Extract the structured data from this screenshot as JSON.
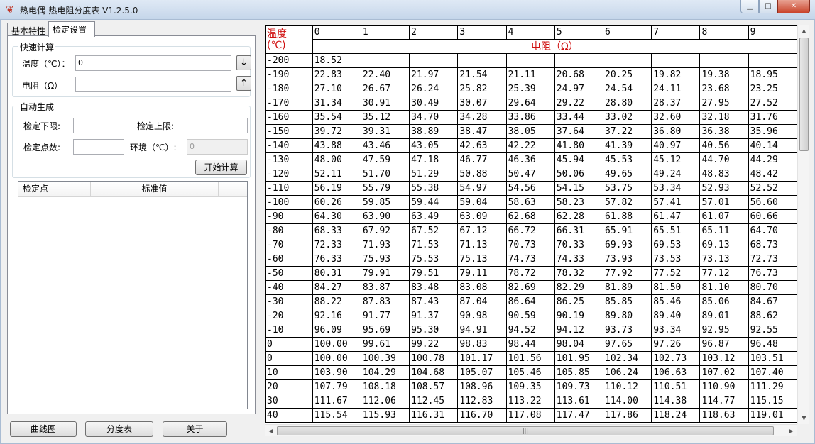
{
  "window": {
    "title": "热电偶-热电阻分度表 V1.2.5.0",
    "app_icon": "flame-icon",
    "minimize": "▁",
    "maximize": "□",
    "close": "✕"
  },
  "tabs": [
    {
      "label": "基本特性"
    },
    {
      "label": "检定设置"
    }
  ],
  "quick_calc": {
    "title": "快速计算",
    "temp_label": "温度（℃）：",
    "temp_value": "0",
    "res_label": "电阻（Ω）",
    "res_value": "",
    "down_arrow": "↓",
    "up_arrow": "↑"
  },
  "auto_gen": {
    "title": "自动生成",
    "lower_label": "检定下限:",
    "upper_label": "检定上限:",
    "points_label": "检定点数:",
    "env_label": "环境（℃）:",
    "env_value": "0",
    "start_button": "开始计算"
  },
  "listview": {
    "columns": [
      "检定点",
      "标准值"
    ]
  },
  "bottom_buttons": {
    "curve": "曲线图",
    "table": "分度表",
    "about": "关于"
  },
  "resistance_table": {
    "temp_header": "温度\n(℃)",
    "temp_header_line1": "温度",
    "temp_header_line2": "(℃)",
    "res_header": "电阻（Ω）",
    "columns": [
      "0",
      "1",
      "2",
      "3",
      "4",
      "5",
      "6",
      "7",
      "8",
      "9"
    ],
    "rows": [
      {
        "t": "-200",
        "v": [
          "18.52",
          "",
          "",
          "",
          "",
          "",
          "",
          "",
          "",
          ""
        ]
      },
      {
        "t": "-190",
        "v": [
          "22.83",
          "22.40",
          "21.97",
          "21.54",
          "21.11",
          "20.68",
          "20.25",
          "19.82",
          "19.38",
          "18.95"
        ]
      },
      {
        "t": "-180",
        "v": [
          "27.10",
          "26.67",
          "26.24",
          "25.82",
          "25.39",
          "24.97",
          "24.54",
          "24.11",
          "23.68",
          "23.25"
        ]
      },
      {
        "t": "-170",
        "v": [
          "31.34",
          "30.91",
          "30.49",
          "30.07",
          "29.64",
          "29.22",
          "28.80",
          "28.37",
          "27.95",
          "27.52"
        ]
      },
      {
        "t": "-160",
        "v": [
          "35.54",
          "35.12",
          "34.70",
          "34.28",
          "33.86",
          "33.44",
          "33.02",
          "32.60",
          "32.18",
          "31.76"
        ]
      },
      {
        "t": "-150",
        "v": [
          "39.72",
          "39.31",
          "38.89",
          "38.47",
          "38.05",
          "37.64",
          "37.22",
          "36.80",
          "36.38",
          "35.96"
        ]
      },
      {
        "t": "-140",
        "v": [
          "43.88",
          "43.46",
          "43.05",
          "42.63",
          "42.22",
          "41.80",
          "41.39",
          "40.97",
          "40.56",
          "40.14"
        ]
      },
      {
        "t": "-130",
        "v": [
          "48.00",
          "47.59",
          "47.18",
          "46.77",
          "46.36",
          "45.94",
          "45.53",
          "45.12",
          "44.70",
          "44.29"
        ]
      },
      {
        "t": "-120",
        "v": [
          "52.11",
          "51.70",
          "51.29",
          "50.88",
          "50.47",
          "50.06",
          "49.65",
          "49.24",
          "48.83",
          "48.42"
        ]
      },
      {
        "t": "-110",
        "v": [
          "56.19",
          "55.79",
          "55.38",
          "54.97",
          "54.56",
          "54.15",
          "53.75",
          "53.34",
          "52.93",
          "52.52"
        ]
      },
      {
        "t": "-100",
        "v": [
          "60.26",
          "59.85",
          "59.44",
          "59.04",
          "58.63",
          "58.23",
          "57.82",
          "57.41",
          "57.01",
          "56.60"
        ]
      },
      {
        "t": "-90",
        "v": [
          "64.30",
          "63.90",
          "63.49",
          "63.09",
          "62.68",
          "62.28",
          "61.88",
          "61.47",
          "61.07",
          "60.66"
        ]
      },
      {
        "t": "-80",
        "v": [
          "68.33",
          "67.92",
          "67.52",
          "67.12",
          "66.72",
          "66.31",
          "65.91",
          "65.51",
          "65.11",
          "64.70"
        ]
      },
      {
        "t": "-70",
        "v": [
          "72.33",
          "71.93",
          "71.53",
          "71.13",
          "70.73",
          "70.33",
          "69.93",
          "69.53",
          "69.13",
          "68.73"
        ]
      },
      {
        "t": "-60",
        "v": [
          "76.33",
          "75.93",
          "75.53",
          "75.13",
          "74.73",
          "74.33",
          "73.93",
          "73.53",
          "73.13",
          "72.73"
        ]
      },
      {
        "t": "-50",
        "v": [
          "80.31",
          "79.91",
          "79.51",
          "79.11",
          "78.72",
          "78.32",
          "77.92",
          "77.52",
          "77.12",
          "76.73"
        ]
      },
      {
        "t": "-40",
        "v": [
          "84.27",
          "83.87",
          "83.48",
          "83.08",
          "82.69",
          "82.29",
          "81.89",
          "81.50",
          "81.10",
          "80.70"
        ]
      },
      {
        "t": "-30",
        "v": [
          "88.22",
          "87.83",
          "87.43",
          "87.04",
          "86.64",
          "86.25",
          "85.85",
          "85.46",
          "85.06",
          "84.67"
        ]
      },
      {
        "t": "-20",
        "v": [
          "92.16",
          "91.77",
          "91.37",
          "90.98",
          "90.59",
          "90.19",
          "89.80",
          "89.40",
          "89.01",
          "88.62"
        ]
      },
      {
        "t": "-10",
        "v": [
          "96.09",
          "95.69",
          "95.30",
          "94.91",
          "94.52",
          "94.12",
          "93.73",
          "93.34",
          "92.95",
          "92.55"
        ]
      },
      {
        "t": "0",
        "v": [
          "100.00",
          "99.61",
          "99.22",
          "98.83",
          "98.44",
          "98.04",
          "97.65",
          "97.26",
          "96.87",
          "96.48"
        ]
      },
      {
        "t": "0",
        "v": [
          "100.00",
          "100.39",
          "100.78",
          "101.17",
          "101.56",
          "101.95",
          "102.34",
          "102.73",
          "103.12",
          "103.51"
        ]
      },
      {
        "t": "10",
        "v": [
          "103.90",
          "104.29",
          "104.68",
          "105.07",
          "105.46",
          "105.85",
          "106.24",
          "106.63",
          "107.02",
          "107.40"
        ]
      },
      {
        "t": "20",
        "v": [
          "107.79",
          "108.18",
          "108.57",
          "108.96",
          "109.35",
          "109.73",
          "110.12",
          "110.51",
          "110.90",
          "111.29"
        ]
      },
      {
        "t": "30",
        "v": [
          "111.67",
          "112.06",
          "112.45",
          "112.83",
          "113.22",
          "113.61",
          "114.00",
          "114.38",
          "114.77",
          "115.15"
        ]
      },
      {
        "t": "40",
        "v": [
          "115.54",
          "115.93",
          "116.31",
          "116.70",
          "117.08",
          "117.47",
          "117.86",
          "118.24",
          "118.63",
          "119.01"
        ]
      }
    ]
  }
}
